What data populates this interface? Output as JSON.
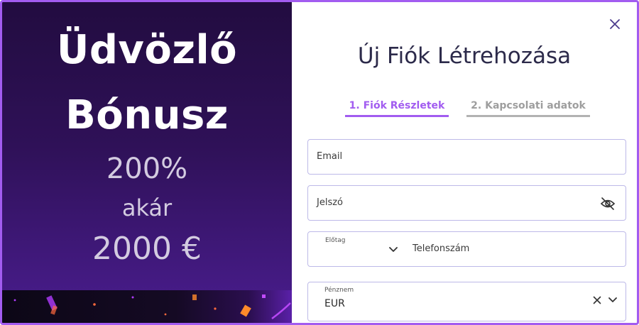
{
  "promo": {
    "heading_line1": "Üdvözlő",
    "heading_line2": "Bónusz",
    "percent": "200%",
    "upto": "akár",
    "amount": "2000 €"
  },
  "form": {
    "title": "Új Fiók Létrehozása",
    "tabs": [
      {
        "label": "1. Fiók Részletek",
        "active": true
      },
      {
        "label": "2. Kapcsolati adatok",
        "active": false
      }
    ],
    "email": {
      "placeholder": "Email"
    },
    "password": {
      "placeholder": "Jelszó"
    },
    "phone": {
      "prefix_label": "Előtag",
      "placeholder": "Telefonszám"
    },
    "currency": {
      "label": "Pénznem",
      "value": "EUR"
    }
  },
  "icons": {
    "close": "close-icon",
    "eye": "eye-slash-icon",
    "chevron": "chevron-down-icon",
    "clear": "clear-icon"
  },
  "colors": {
    "accent": "#a25cf0",
    "promo_bg_top": "#220c40",
    "promo_bg_bottom": "#4a1d8f",
    "field_border": "#bdb9e8",
    "inactive_tab": "#9e9e9e",
    "title_text": "#2c2a4a"
  }
}
